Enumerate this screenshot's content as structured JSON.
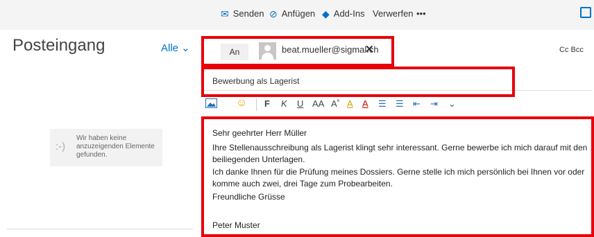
{
  "toolbar": {
    "send_label": "Senden",
    "attach_label": "Anfügen",
    "addins_label": "Add-Ins",
    "discard_label": "Verwerfen",
    "more_label": "•••"
  },
  "inbox": {
    "title": "Posteingang",
    "filter_label": "Alle ⌄",
    "empty_face": ":-)",
    "empty_message": "Wir haben keine anzuzeigenden Elemente gefunden."
  },
  "compose": {
    "to_label": "An",
    "recipient": "beat.mueller@sigmal.ch",
    "remove_recipient": "✕",
    "cc_bcc_label": "Cc  Bcc",
    "subject": "Bewerbung als Lagerist",
    "format_buttons": [
      "F",
      "K",
      "U",
      "AA",
      "A˚",
      "A",
      "A",
      "☰",
      "☰",
      "⇤",
      "⇥",
      "⌄"
    ],
    "body": {
      "greeting": "Sehr geehrter Herr Müller",
      "paragraph1": "Ihre Stellenausschreibung als Lagerist klingt sehr interessant. Gerne bewerbe ich mich darauf mit den beiliegenden Unterlagen.",
      "paragraph2": "Ich danke Ihnen für die Prüfung meines Dossiers. Gerne stelle ich mich persönlich bei Ihnen vor oder komme auch zwei, drei Tage zum Probearbeiten.",
      "closing": "Freundliche Grüsse",
      "signature": "Peter Muster"
    }
  },
  "colors": {
    "accent": "#0072c6",
    "highlight": "#e8000b"
  }
}
